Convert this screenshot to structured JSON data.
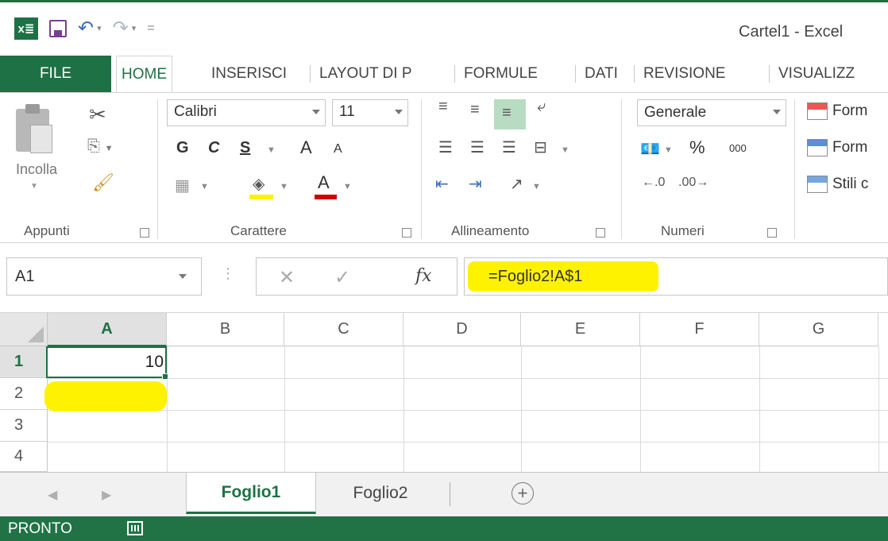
{
  "window": {
    "title": "Cartel1 - Excel"
  },
  "qat": {
    "logo": "x≣",
    "undo_icon": "undo-icon",
    "redo_icon": "redo-icon",
    "customize": "="
  },
  "tabs": {
    "file": "FILE",
    "items": [
      "HOME",
      "INSERISCI",
      "LAYOUT DI P",
      "FORMULE",
      "DATI",
      "REVISIONE",
      "VISUALIZZ"
    ],
    "active": "HOME"
  },
  "ribbon": {
    "clipboard": {
      "paste": "Incolla",
      "label": "Appunti"
    },
    "font": {
      "name": "Calibri",
      "size": "11",
      "bold": "G",
      "italic": "C",
      "underline": "S",
      "grow": "A",
      "shrink": "A",
      "color": "A",
      "label": "Carattere"
    },
    "alignment": {
      "label": "Allineamento"
    },
    "number": {
      "format": "Generale",
      "percent": "%",
      "thousands": "000",
      "label": "Numeri"
    },
    "styles": {
      "conditional": "Form",
      "table": "Form",
      "cell": "Stili c"
    }
  },
  "formula_bar": {
    "name_box": "A1",
    "fx": "fx",
    "formula": "=Foglio2!A$1"
  },
  "grid": {
    "columns": [
      "A",
      "B",
      "C",
      "D",
      "E",
      "F",
      "G"
    ],
    "rows": [
      "1",
      "2",
      "3",
      "4"
    ],
    "active_cell": "A1",
    "a1_value": "10"
  },
  "sheets": {
    "items": [
      "Foglio1",
      "Foglio2"
    ],
    "active": "Foglio1",
    "add": "+"
  },
  "status": {
    "text": "PRONTO"
  },
  "colors": {
    "excel_green": "#217346",
    "highlight": "#fff200"
  }
}
